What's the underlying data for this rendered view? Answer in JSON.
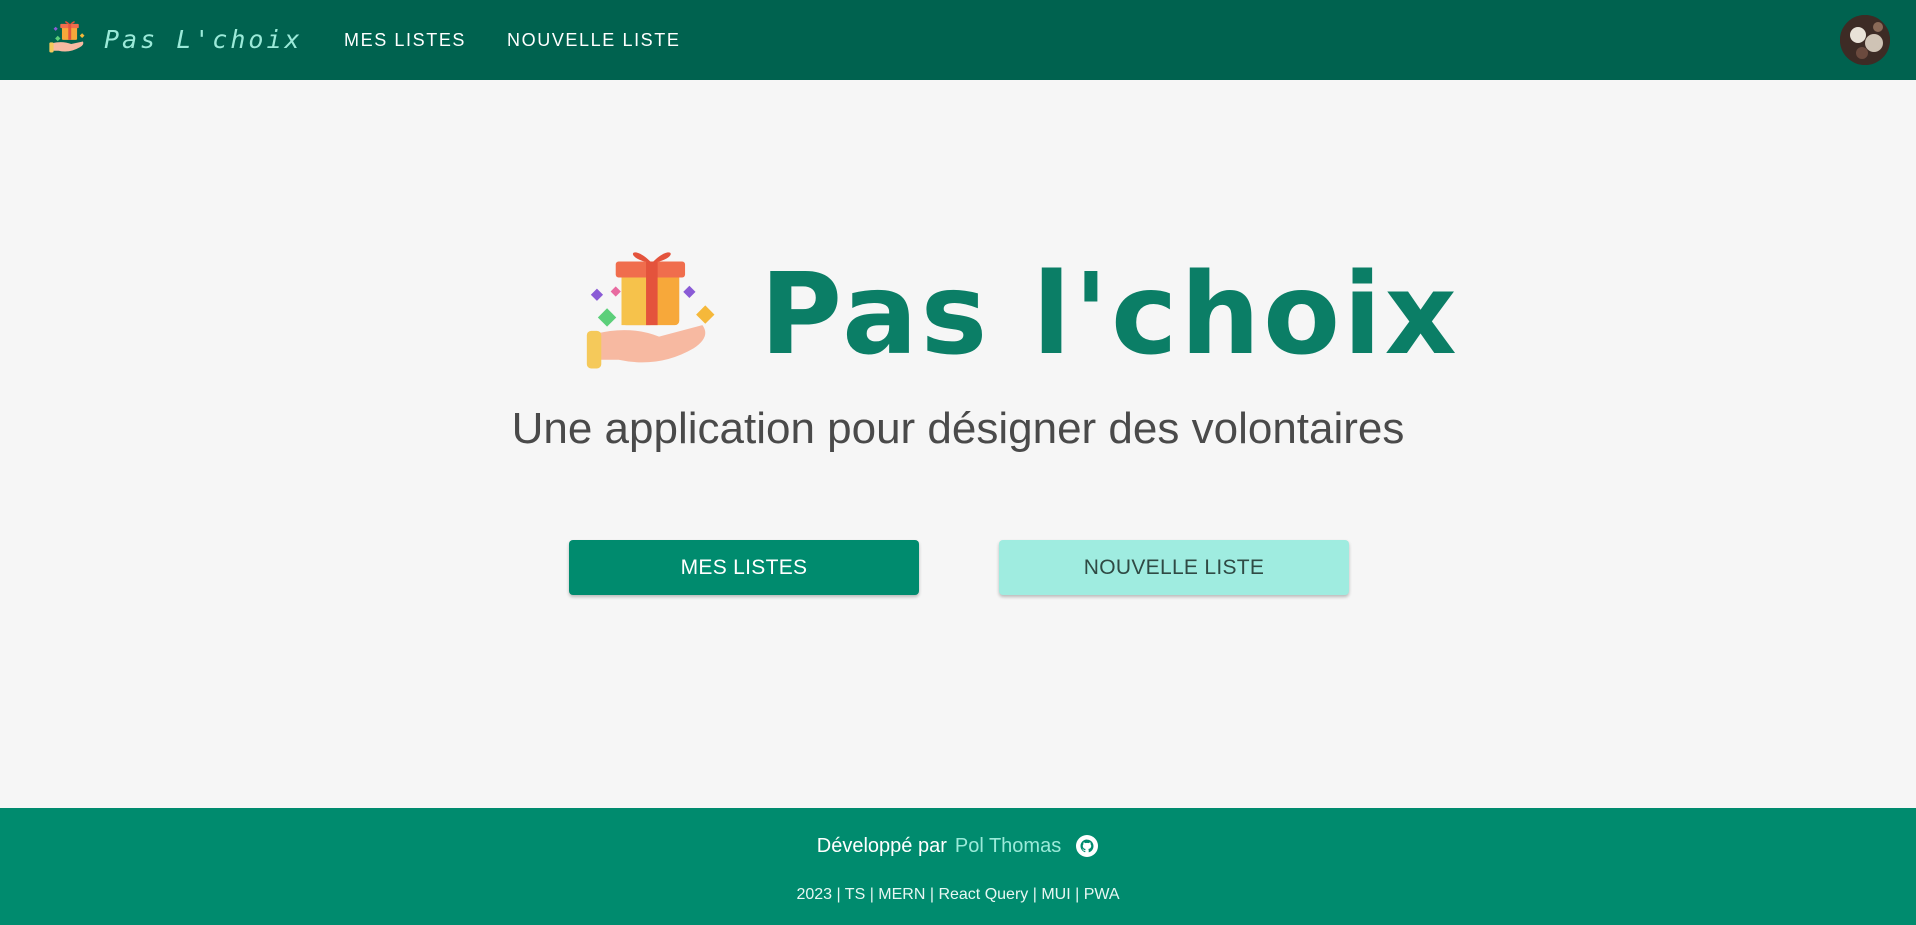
{
  "header": {
    "brand": "Pas L'choix",
    "nav": [
      {
        "label": "MES LISTES"
      },
      {
        "label": "NOUVELLE LISTE"
      }
    ]
  },
  "hero": {
    "title": "Pas l'choix",
    "subtitle": "Une application pour désigner des volontaires",
    "primary_button": "MES LISTES",
    "secondary_button": "NOUVELLE LISTE"
  },
  "footer": {
    "developed_by": "Développé par",
    "author": "Pol Thomas",
    "stack": "2023 | TS | MERN | React Query | MUI | PWA"
  },
  "colors": {
    "header_bg": "#00624f",
    "accent": "#008b6e",
    "accent_light": "#9fece0",
    "brand_text": "#9bead9"
  },
  "icons": [
    "gift-hand-logo-icon",
    "avatar",
    "github-icon"
  ]
}
